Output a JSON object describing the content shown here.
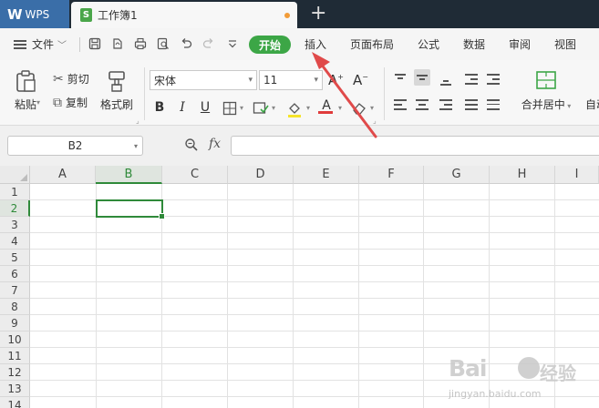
{
  "titlebar": {
    "app_name": "WPS",
    "doc_tab": "工作簿1",
    "new_tab": "+"
  },
  "menubar": {
    "file_menu": "文件",
    "tabs": [
      "开始",
      "插入",
      "页面布局",
      "公式",
      "数据",
      "审阅",
      "视图"
    ],
    "active_tab": "开始"
  },
  "ribbon": {
    "paste": "粘贴",
    "cut": "剪切",
    "copy": "复制",
    "format_painter": "格式刷",
    "font_name": "宋体",
    "font_size": "11",
    "bold": "B",
    "italic": "I",
    "underline": "U",
    "font_color_glyph": "A",
    "merge_center": "合并居中",
    "auto_wrap_partial": "自动"
  },
  "formula_bar": {
    "name_box": "B2",
    "fx": "fx",
    "formula": ""
  },
  "sheet": {
    "columns": [
      "A",
      "B",
      "C",
      "D",
      "E",
      "F",
      "G",
      "H",
      "I"
    ],
    "rows": [
      "1",
      "2",
      "3",
      "4",
      "5",
      "6",
      "7",
      "8",
      "9",
      "10",
      "11",
      "12",
      "13",
      "14"
    ],
    "selected_column": "B",
    "selected_row": "2",
    "active_cell": "B2"
  },
  "watermark": {
    "logo": "Bai",
    "brand": "经验",
    "url": "jingyan.baidu.com"
  },
  "colors": {
    "accent_green": "#3ca646",
    "annotation_arrow": "#e04a4a",
    "titlebar_bg": "#1f2b36",
    "wps_tab_bg": "#3a6ea8"
  }
}
